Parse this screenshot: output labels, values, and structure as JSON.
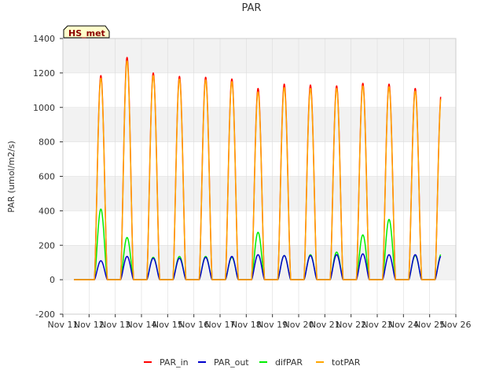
{
  "chart_data": {
    "type": "line",
    "title": "PAR",
    "ylabel": "PAR (umol/m2/s)",
    "xlabel": "",
    "badge": "HS_met",
    "ylim": [
      -200,
      1400
    ],
    "yticks": [
      -200,
      0,
      200,
      400,
      600,
      800,
      1000,
      1200,
      1400
    ],
    "xlim": [
      "2021-11-11",
      "2021-11-26"
    ],
    "xtick_labels": [
      "Nov 11",
      "Nov 12",
      "Nov 13",
      "Nov 14",
      "Nov 15",
      "Nov 16",
      "Nov 17",
      "Nov 18",
      "Nov 19",
      "Nov 20",
      "Nov 21",
      "Nov 22",
      "Nov 23",
      "Nov 24",
      "Nov 25",
      "Nov 26"
    ],
    "grid": true,
    "legend_position": "bottom",
    "colors": {
      "PAR_in": "#ff0000",
      "PAR_out": "#0000cc",
      "difPAR": "#00ee00",
      "totPAR": "#ffa500",
      "band": "#f2f2f2",
      "grid": "#dcdcdc",
      "badge_bg": "#ffffcc"
    },
    "series": [
      {
        "name": "PAR_in",
        "daily_peaks": [
          1185,
          1290,
          1200,
          1180,
          1175,
          1165,
          1110,
          1135,
          1130,
          1125,
          1140,
          1135,
          1110,
          1090
        ]
      },
      {
        "name": "PAR_out",
        "daily_peaks": [
          110,
          135,
          125,
          125,
          130,
          135,
          145,
          140,
          140,
          145,
          150,
          145,
          145,
          140
        ]
      },
      {
        "name": "difPAR",
        "daily_peaks": [
          410,
          245,
          130,
          135,
          135,
          130,
          275,
          140,
          145,
          160,
          260,
          350,
          140,
          150
        ]
      },
      {
        "name": "totPAR",
        "daily_peaks": [
          1170,
          1270,
          1185,
          1165,
          1160,
          1150,
          1090,
          1115,
          1110,
          1110,
          1125,
          1120,
          1095,
          1075
        ]
      }
    ],
    "day_dates": [
      "Nov 12",
      "Nov 13",
      "Nov 14",
      "Nov 15",
      "Nov 16",
      "Nov 17",
      "Nov 18",
      "Nov 19",
      "Nov 20",
      "Nov 21",
      "Nov 22",
      "Nov 23",
      "Nov 24",
      "Nov 25"
    ],
    "data_start": "2021-11-11 10:00",
    "data_end": "2021-11-25 10:00"
  }
}
